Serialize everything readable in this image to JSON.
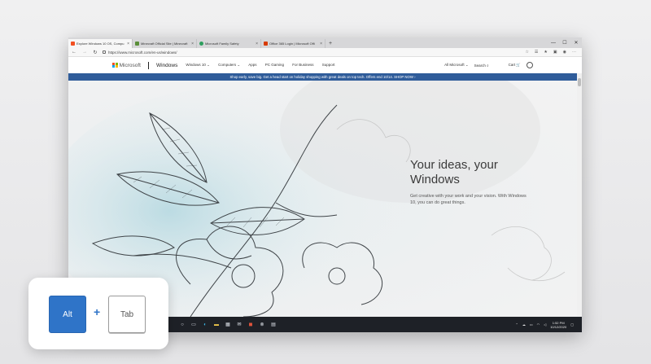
{
  "browser": {
    "tabs": [
      {
        "title": "Explore Windows 10 OS, Compu",
        "favicon_color": "#f25022",
        "active": true
      },
      {
        "title": "Minecraft Official Site | Minecraft",
        "favicon_color": "#5b8f3a",
        "active": false
      },
      {
        "title": "Microsoft Family Safety",
        "favicon_color": "#2e9f5e",
        "active": false
      },
      {
        "title": "Office 365 Login | Microsoft Offi",
        "favicon_color": "#d83b01",
        "active": false
      }
    ],
    "tab_close_glyph": "×",
    "new_tab_glyph": "+",
    "url": "https://www.microsoft.com/en-us/windows/"
  },
  "site_header": {
    "brand": "Microsoft",
    "product": "Windows",
    "menu": [
      "Windows 10 ⌄",
      "Computers ⌄",
      "Apps",
      "PC Gaming",
      "For Business",
      "Support"
    ],
    "all_microsoft": "All Microsoft ⌄",
    "search": "Search ⌕",
    "cart": "Cart 🛒"
  },
  "promo_banner": "Shop early, save big. Get a head start on holiday shopping with great deals on top tech. Offers end 10/14. SHOP NOW ›",
  "hero": {
    "title": "Your ideas, your Windows",
    "subtitle": "Get creative with your work and your vision. With Windows 10, you can do great things."
  },
  "taskbar": {
    "time": "1:52 PM",
    "date": "10/12/2020"
  },
  "shortcut": {
    "key1": "Alt",
    "plus": "+",
    "key2": "Tab"
  },
  "colors": {
    "promo": "#2f5c9a",
    "alt_key": "#2f74c8",
    "taskbar": "#1e2127"
  }
}
